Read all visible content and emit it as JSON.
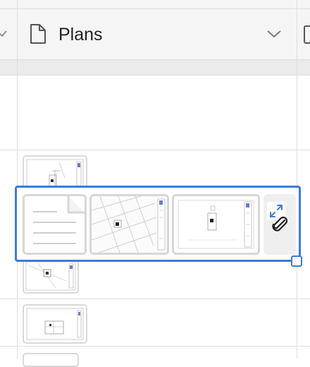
{
  "header": {
    "field_title": "Plans",
    "field_type_icon": "document-icon",
    "menu_icon": "chevron-down-icon"
  },
  "cell_editor": {
    "attachments": [
      "text-document",
      "site-plan",
      "floor-plan"
    ],
    "expand_icon": "expand-icon",
    "attach_icon": "paperclip-icon"
  },
  "colors": {
    "accent": "#3f7ad6",
    "grid_line": "#dedede",
    "header_bg": "#f5f5f5"
  }
}
